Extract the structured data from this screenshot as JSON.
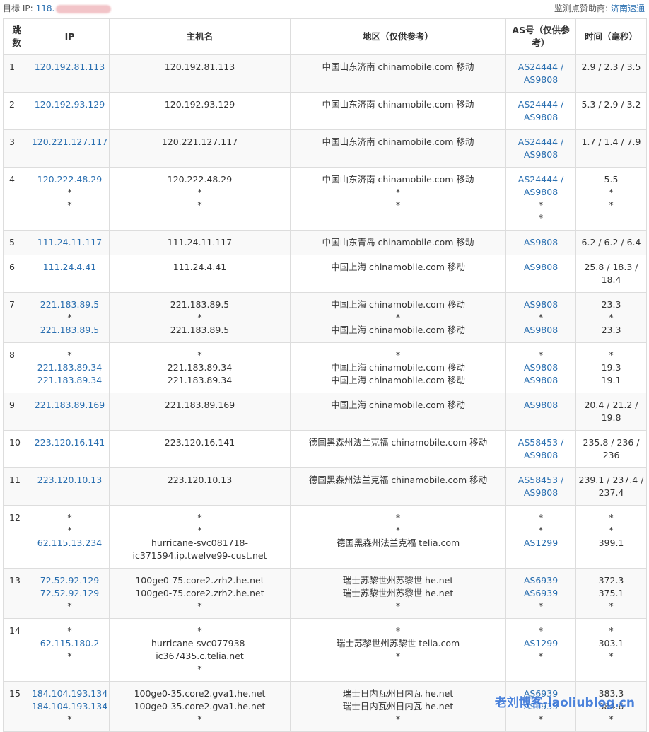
{
  "header": {
    "target_label": "目标 IP:",
    "target_ip": "118.",
    "sponsor_label": "监测点赞助商:",
    "sponsor_name": "济南速通"
  },
  "columns": [
    "跳数",
    "IP",
    "主机名",
    "地区（仅供参考）",
    "AS号（仅供参考）",
    "时间（毫秒）"
  ],
  "hops": [
    {
      "hop": "1",
      "ip": [
        "120.192.81.113"
      ],
      "host": [
        "120.192.81.113"
      ],
      "region": [
        "中国山东济南 chinamobile.com 移动"
      ],
      "as": [
        "AS24444 / AS9808"
      ],
      "time": [
        "2.9 / 2.3 / 3.5"
      ]
    },
    {
      "hop": "2",
      "ip": [
        "120.192.93.129"
      ],
      "host": [
        "120.192.93.129"
      ],
      "region": [
        "中国山东济南 chinamobile.com 移动"
      ],
      "as": [
        "AS24444 / AS9808"
      ],
      "time": [
        "5.3 / 2.9 / 3.2"
      ]
    },
    {
      "hop": "3",
      "ip": [
        "120.221.127.117"
      ],
      "host": [
        "120.221.127.117"
      ],
      "region": [
        "中国山东济南 chinamobile.com 移动"
      ],
      "as": [
        "AS24444 / AS9808"
      ],
      "time": [
        "1.7 / 1.4 / 7.9"
      ]
    },
    {
      "hop": "4",
      "ip": [
        "120.222.48.29",
        "*",
        "*"
      ],
      "host": [
        "120.222.48.29",
        "*",
        "*"
      ],
      "region": [
        "中国山东济南 chinamobile.com 移动",
        "*",
        "*"
      ],
      "as": [
        "AS24444 / AS9808",
        "*",
        "*"
      ],
      "time": [
        "5.5",
        "*",
        "*"
      ]
    },
    {
      "hop": "5",
      "ip": [
        "111.24.11.117"
      ],
      "host": [
        "111.24.11.117"
      ],
      "region": [
        "中国山东青岛 chinamobile.com 移动"
      ],
      "as": [
        "AS9808"
      ],
      "time": [
        "6.2 / 6.2 / 6.4"
      ]
    },
    {
      "hop": "6",
      "ip": [
        "111.24.4.41"
      ],
      "host": [
        "111.24.4.41"
      ],
      "region": [
        "中国上海 chinamobile.com 移动"
      ],
      "as": [
        "AS9808"
      ],
      "time": [
        "25.8 / 18.3 / 18.4"
      ]
    },
    {
      "hop": "7",
      "ip": [
        "221.183.89.5",
        "*",
        "221.183.89.5"
      ],
      "host": [
        "221.183.89.5",
        "*",
        "221.183.89.5"
      ],
      "region": [
        "中国上海 chinamobile.com 移动",
        "*",
        "中国上海 chinamobile.com 移动"
      ],
      "as": [
        "AS9808",
        "*",
        "AS9808"
      ],
      "time": [
        "23.3",
        "*",
        "23.3"
      ]
    },
    {
      "hop": "8",
      "ip": [
        "*",
        "221.183.89.34",
        "221.183.89.34"
      ],
      "host": [
        "*",
        "221.183.89.34",
        "221.183.89.34"
      ],
      "region": [
        "*",
        "中国上海 chinamobile.com 移动",
        "中国上海 chinamobile.com 移动"
      ],
      "as": [
        "*",
        "AS9808",
        "AS9808"
      ],
      "time": [
        "*",
        "19.3",
        "19.1"
      ]
    },
    {
      "hop": "9",
      "ip": [
        "221.183.89.169"
      ],
      "host": [
        "221.183.89.169"
      ],
      "region": [
        "中国上海 chinamobile.com 移动"
      ],
      "as": [
        "AS9808"
      ],
      "time": [
        "20.4 / 21.2 / 19.8"
      ]
    },
    {
      "hop": "10",
      "ip": [
        "223.120.16.141"
      ],
      "host": [
        "223.120.16.141"
      ],
      "region": [
        "德国黑森州法兰克福 chinamobile.com 移动"
      ],
      "as": [
        "AS58453 / AS9808"
      ],
      "time": [
        "235.8 / 236 / 236"
      ]
    },
    {
      "hop": "11",
      "ip": [
        "223.120.10.13"
      ],
      "host": [
        "223.120.10.13"
      ],
      "region": [
        "德国黑森州法兰克福 chinamobile.com 移动"
      ],
      "as": [
        "AS58453 / AS9808"
      ],
      "time": [
        "239.1 / 237.4 / 237.4"
      ]
    },
    {
      "hop": "12",
      "ip": [
        "*",
        "*",
        "62.115.13.234"
      ],
      "host": [
        "*",
        "*",
        "hurricane-svc081718-ic371594.ip.twelve99-cust.net"
      ],
      "region": [
        "*",
        "*",
        "德国黑森州法兰克福 telia.com"
      ],
      "as": [
        "*",
        "*",
        "AS1299"
      ],
      "time": [
        "*",
        "*",
        "399.1"
      ]
    },
    {
      "hop": "13",
      "ip": [
        "72.52.92.129",
        "72.52.92.129",
        "*"
      ],
      "host": [
        "100ge0-75.core2.zrh2.he.net",
        "100ge0-75.core2.zrh2.he.net",
        "*"
      ],
      "region": [
        "瑞士苏黎世州苏黎世 he.net",
        "瑞士苏黎世州苏黎世 he.net",
        "*"
      ],
      "as": [
        "AS6939",
        "AS6939",
        "*"
      ],
      "time": [
        "372.3",
        "375.1",
        "*"
      ]
    },
    {
      "hop": "14",
      "ip": [
        "*",
        "62.115.180.2",
        "*"
      ],
      "host": [
        "*",
        "hurricane-svc077938-ic367435.c.telia.net",
        "*"
      ],
      "region": [
        "*",
        "瑞士苏黎世州苏黎世 telia.com",
        "*"
      ],
      "as": [
        "*",
        "AS1299",
        "*"
      ],
      "time": [
        "*",
        "303.1",
        "*"
      ]
    },
    {
      "hop": "15",
      "ip": [
        "184.104.193.134",
        "184.104.193.134",
        "*"
      ],
      "host": [
        "100ge0-35.core2.gva1.he.net",
        "100ge0-35.core2.gva1.he.net",
        "*"
      ],
      "region": [
        "瑞士日内瓦州日内瓦 he.net",
        "瑞士日内瓦州日内瓦 he.net",
        "*"
      ],
      "as": [
        "AS6939",
        "AS6939",
        "*"
      ],
      "time": [
        "383.3",
        "384.6",
        "*"
      ]
    }
  ],
  "watermark": "老刘博客-laoliublog.cn"
}
